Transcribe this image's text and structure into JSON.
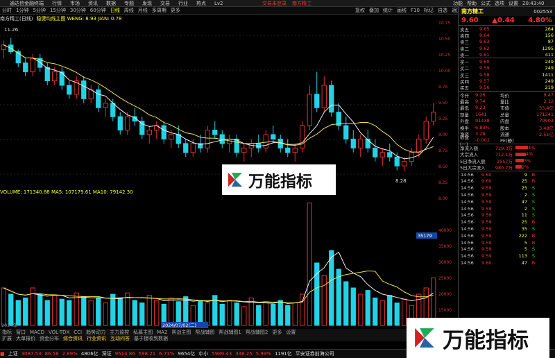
{
  "titlebar": {
    "app": "通达信金融终端",
    "menus": [
      "行情",
      "市场",
      "资讯",
      "数据",
      "专题",
      "发现",
      "交易",
      "行业",
      "热点",
      "Lv2"
    ],
    "center": [
      "交易未登录",
      "南方精工"
    ],
    "right": [
      "功能",
      "帮助",
      "公式",
      "选项",
      "设置"
    ],
    "time": "20:43:40"
  },
  "toolbar": {
    "periods": [
      "分时",
      "1分钟",
      "5分钟",
      "15分钟",
      "30分钟",
      "60分钟",
      "日线",
      "周线",
      "月线",
      "多周期",
      "更多"
    ],
    "active": "日线",
    "right": [
      "复权",
      "叠加",
      "统计",
      "画线",
      "F10",
      "标记",
      "自选",
      "返回"
    ]
  },
  "chart": {
    "head": [
      "南方精工(日线)",
      "稳健均线主图 WENG: 8.93 JIAN: 0.78"
    ],
    "high_label": "11.26",
    "low_label": "8.28",
    "colors": {
      "up": "#e83030",
      "down": "#22d3e6",
      "ma5": "#f0f0f0",
      "ma10": "#f0e04a"
    }
  },
  "chart_data": {
    "type": "candlestick",
    "ylim": [
      8.0,
      11.5
    ],
    "candles": [
      [
        11.0,
        11.2,
        10.8,
        11.1
      ],
      [
        11.1,
        11.26,
        10.9,
        10.95
      ],
      [
        10.95,
        11.0,
        10.6,
        10.7
      ],
      [
        10.7,
        10.8,
        10.4,
        10.5
      ],
      [
        10.5,
        10.9,
        10.4,
        10.8
      ],
      [
        10.8,
        10.9,
        10.5,
        10.6
      ],
      [
        10.6,
        10.7,
        10.2,
        10.3
      ],
      [
        10.3,
        10.6,
        10.2,
        10.5
      ],
      [
        10.5,
        10.6,
        10.1,
        10.2
      ],
      [
        10.2,
        10.3,
        9.9,
        10.0
      ],
      [
        10.0,
        10.4,
        9.9,
        10.3
      ],
      [
        10.3,
        10.4,
        9.8,
        9.9
      ],
      [
        9.9,
        10.2,
        9.8,
        10.1
      ],
      [
        10.1,
        10.2,
        9.6,
        9.7
      ],
      [
        9.7,
        9.9,
        9.5,
        9.8
      ],
      [
        9.8,
        9.9,
        9.4,
        9.5
      ],
      [
        9.5,
        9.6,
        9.1,
        9.2
      ],
      [
        9.2,
        9.6,
        9.1,
        9.5
      ],
      [
        9.5,
        9.7,
        9.3,
        9.4
      ],
      [
        9.4,
        9.5,
        9.0,
        9.1
      ],
      [
        9.1,
        9.3,
        8.9,
        9.2
      ],
      [
        9.2,
        9.4,
        9.0,
        9.3
      ],
      [
        9.3,
        9.4,
        8.9,
        9.0
      ],
      [
        9.0,
        9.2,
        8.8,
        9.1
      ],
      [
        9.1,
        9.3,
        8.8,
        8.9
      ],
      [
        8.9,
        9.0,
        8.6,
        8.7
      ],
      [
        8.7,
        9.0,
        8.6,
        8.9
      ],
      [
        8.9,
        9.1,
        8.7,
        8.8
      ],
      [
        8.8,
        9.3,
        8.7,
        9.2
      ],
      [
        9.2,
        9.4,
        9.0,
        9.1
      ],
      [
        9.1,
        9.2,
        8.8,
        8.9
      ],
      [
        8.9,
        9.1,
        8.7,
        9.0
      ],
      [
        9.0,
        9.1,
        8.6,
        8.7
      ],
      [
        8.7,
        8.9,
        8.5,
        8.8
      ],
      [
        8.8,
        9.0,
        8.6,
        8.9
      ],
      [
        8.9,
        9.1,
        8.7,
        8.8
      ],
      [
        8.8,
        9.2,
        8.7,
        9.1
      ],
      [
        9.1,
        9.3,
        8.9,
        9.0
      ],
      [
        9.0,
        9.1,
        8.7,
        8.8
      ],
      [
        8.8,
        9.0,
        8.6,
        8.7
      ],
      [
        8.7,
        8.9,
        8.5,
        8.8
      ],
      [
        8.8,
        9.4,
        8.7,
        9.3
      ],
      [
        9.3,
        10.2,
        9.2,
        10.0
      ],
      [
        10.0,
        10.5,
        9.6,
        9.7
      ],
      [
        9.7,
        10.4,
        9.6,
        10.2
      ],
      [
        10.2,
        10.3,
        9.5,
        9.6
      ],
      [
        9.6,
        9.8,
        9.2,
        9.3
      ],
      [
        9.3,
        9.5,
        8.9,
        9.0
      ],
      [
        9.0,
        9.2,
        8.7,
        8.8
      ],
      [
        8.8,
        9.1,
        8.6,
        9.0
      ],
      [
        9.0,
        9.2,
        8.7,
        8.8
      ],
      [
        8.8,
        9.0,
        8.5,
        8.6
      ],
      [
        8.6,
        8.8,
        8.4,
        8.7
      ],
      [
        8.7,
        8.9,
        8.5,
        8.6
      ],
      [
        8.6,
        8.7,
        8.3,
        8.4
      ],
      [
        8.4,
        8.6,
        8.28,
        8.5
      ],
      [
        8.5,
        8.8,
        8.4,
        8.7
      ],
      [
        8.7,
        9.1,
        8.6,
        9.0
      ],
      [
        9.0,
        9.5,
        8.9,
        9.4
      ],
      [
        9.4,
        9.8,
        9.3,
        9.6
      ]
    ],
    "volumes": [
      3,
      2.5,
      2,
      2.2,
      3,
      2.5,
      2,
      2.4,
      2.1,
      2,
      2.6,
      2.3,
      2,
      2.2,
      1.8,
      2.5,
      2.2,
      2.6,
      2,
      1.8,
      2.4,
      2,
      1.7,
      2.2,
      1.9,
      2.3,
      1.6,
      2,
      1.8,
      2.4,
      1.7,
      2,
      1.8,
      1.5,
      2.2,
      1.6,
      1.9,
      1.7,
      2,
      1.6,
      1.8,
      2.5,
      9.8,
      5,
      4,
      6,
      4.5,
      3.5,
      3,
      2.5,
      2.8,
      2.2,
      2,
      2.4,
      1.8,
      2.1,
      1.6,
      2.5,
      3,
      3.8
    ]
  },
  "vol": {
    "head": "VOLUME: 171340.88 MA5: 107179.61 MA10: 79142.30",
    "marker": "35179",
    "dates": [
      "2024年",
      "2024/07/02(二)"
    ]
  },
  "tabs1": [
    "指标",
    "窗口",
    "MACD",
    "VOL-TDX",
    "CCI",
    "趋势动力",
    "主力监控",
    "私募主图",
    "MA2",
    "帮战主图",
    "帮战辅图",
    "帮战辅图1",
    "帮战辅图2",
    "更多",
    "设置"
  ],
  "tabs2": [
    "扩展",
    "大单报价",
    "资金分布",
    "综合资讯",
    "行业资讯",
    "互动问答",
    "基于接收到数据"
  ],
  "axis": [
    "10.75",
    "10.50",
    "10.25",
    "10.00",
    "9.75",
    "9.50",
    "9.25",
    "9.00",
    "8.75",
    "8.50",
    "8.25",
    "8.00",
    "",
    "40000",
    "35000",
    "30000",
    "25000",
    "20000",
    "15000",
    "10000",
    "X10"
  ],
  "panel": {
    "name": "南方精工",
    "code": "002553",
    "price": "9.60",
    "change": "▲0.44",
    "pct": "4.80%",
    "asks": [
      [
        "卖五",
        "9.65",
        "264"
      ],
      [
        "卖四",
        "9.64",
        "156"
      ],
      [
        "卖三",
        "9.63",
        "87"
      ],
      [
        "卖二",
        "9.62",
        "1295"
      ],
      [
        "卖一",
        "9.61",
        "411"
      ]
    ],
    "bids": [
      [
        "买一",
        "9.60",
        "249"
      ],
      [
        "买二",
        "9.59",
        "249"
      ],
      [
        "买三",
        "9.58",
        "1411"
      ],
      [
        "买四",
        "9.57",
        "249"
      ],
      [
        "买五",
        "9.56",
        "219"
      ]
    ],
    "stats": [
      [
        "今开",
        "9.26",
        "均价",
        "9.47"
      ],
      [
        "最高",
        "9.74",
        "量比",
        "2.12"
      ],
      [
        "最低",
        "9.23",
        "市值",
        "33.4亿"
      ],
      [
        "现量",
        "1641",
        "总量",
        "171341"
      ],
      [
        "外盘",
        "91438",
        "内盘",
        "79903"
      ],
      [
        "换手",
        "6.83%",
        "股本",
        "3.48亿"
      ],
      [
        "净资",
        "3.28",
        "流通",
        "2.51亿"
      ],
      [
        "收益(一)",
        "-0.002",
        "PE(静)",
        ""
      ]
    ],
    "flows": [
      [
        "净流入额",
        "729.3万",
        "4%"
      ],
      [
        "大宗流入",
        "712.1万",
        "4%"
      ],
      [
        "5日净流入额",
        "2557万",
        "3%"
      ],
      [
        "5日大宗流入",
        "980.7万",
        "2%"
      ]
    ],
    "ticks": [
      [
        "14:56",
        "9.60",
        "9",
        "B"
      ],
      [
        "14:56",
        "9.60",
        "25",
        "B"
      ],
      [
        "14:56",
        "9.59",
        "25",
        "S"
      ],
      [
        "14:56",
        "9.59",
        "2",
        "S"
      ],
      [
        "14:56",
        "9.59",
        "47",
        "S"
      ],
      [
        "14:56",
        "9.59",
        "2",
        "S"
      ],
      [
        "14:56",
        "9.59",
        "11",
        "S"
      ],
      [
        "14:56",
        "9.59",
        "25",
        "B"
      ],
      [
        "14:56",
        "9.59",
        "35",
        "S"
      ],
      [
        "14:56",
        "9.59",
        "222",
        "B"
      ],
      [
        "14:56",
        "9.59",
        "5",
        "B"
      ],
      [
        "14:56",
        "9.59",
        "5",
        "S"
      ],
      [
        "14:56",
        "9.59",
        "113",
        "S"
      ],
      [
        "14:56",
        "9.60",
        "47",
        "B"
      ]
    ]
  },
  "status": {
    "items": [
      [
        "上证",
        "3087.53",
        "86.58",
        "2.89%",
        "4806亿"
      ],
      [
        "深证",
        "9514.86",
        "598.21",
        "6.71%",
        "9654亿"
      ],
      [
        "中小",
        "5989.43",
        "338.25",
        "5.99%",
        "1191亿"
      ]
    ],
    "right": "平安证券前海公司"
  },
  "watermark": "万能指标"
}
